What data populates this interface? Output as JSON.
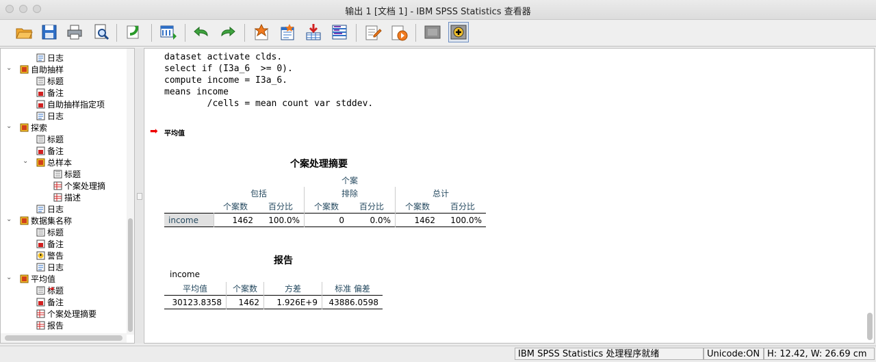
{
  "window": {
    "title": "输出 1 [文档 1] - IBM SPSS Statistics 查看器"
  },
  "toolbar": {
    "buttons": [
      "open-icon",
      "save-icon",
      "print-icon",
      "print-preview-icon",
      "export-icon",
      "goto-data-icon",
      "undo-icon",
      "redo-icon",
      "insert-heading-icon",
      "insert-title-icon",
      "insert-text-icon",
      "designate-window-icon",
      "edit-syntax-icon",
      "run-icon",
      "hide-icon",
      "show-icon"
    ]
  },
  "tree": {
    "items": [
      {
        "label": "日志",
        "icon": "log-icon"
      },
      {
        "label": "自助抽样",
        "icon": "book-icon"
      },
      {
        "label": "标题",
        "icon": "title-icon"
      },
      {
        "label": "备注",
        "icon": "notes-icon"
      },
      {
        "label": "自助抽样指定项",
        "icon": "notes-icon"
      },
      {
        "label": "日志",
        "icon": "log-icon"
      },
      {
        "label": "探索",
        "icon": "book-icon"
      },
      {
        "label": "标题",
        "icon": "title-icon"
      },
      {
        "label": "备注",
        "icon": "notes-icon"
      },
      {
        "label": "总样本",
        "icon": "book-icon"
      },
      {
        "label": "标题",
        "icon": "title-icon"
      },
      {
        "label": "个案处理摘",
        "icon": "table-icon"
      },
      {
        "label": "描述",
        "icon": "table-icon"
      },
      {
        "label": "日志",
        "icon": "log-icon"
      },
      {
        "label": "数据集名称",
        "icon": "book-icon"
      },
      {
        "label": "标题",
        "icon": "title-icon"
      },
      {
        "label": "备注",
        "icon": "notes-icon"
      },
      {
        "label": "警告",
        "icon": "warning-icon"
      },
      {
        "label": "日志",
        "icon": "log-icon"
      },
      {
        "label": "平均值",
        "icon": "book-icon"
      },
      {
        "label": "标题",
        "icon": "title-icon"
      },
      {
        "label": "备注",
        "icon": "notes-icon"
      },
      {
        "label": "个案处理摘要",
        "icon": "table-icon"
      },
      {
        "label": "报告",
        "icon": "table-icon"
      }
    ]
  },
  "output": {
    "syntax": "dataset activate clds.\nselect if (I3a_6  >= 0).\ncompute income = I3a_6.\nmeans income\n        /cells = mean count var stddev.",
    "section_heading": "平均值",
    "case_summary": {
      "title": "个案处理摘要",
      "group_header": "个案",
      "col_groups": [
        "包括",
        "排除",
        "总计"
      ],
      "sub_headers": [
        "个案数",
        "百分比",
        "个案数",
        "百分比",
        "个案数",
        "百分比"
      ],
      "row_label": "income",
      "values": [
        "1462",
        "100.0%",
        "0",
        "0.0%",
        "1462",
        "100.0%"
      ]
    },
    "report": {
      "title": "报告",
      "var_label": "income",
      "headers": [
        "平均值",
        "个案数",
        "方差",
        "标准 偏差"
      ],
      "values": [
        "30123.8358",
        "1462",
        "1.926E+9",
        "43886.0598"
      ]
    }
  },
  "status": {
    "processor": "IBM SPSS Statistics 处理程序就绪",
    "unicode": "Unicode:ON",
    "dims": "H: 12.42, W: 26.69 cm"
  }
}
